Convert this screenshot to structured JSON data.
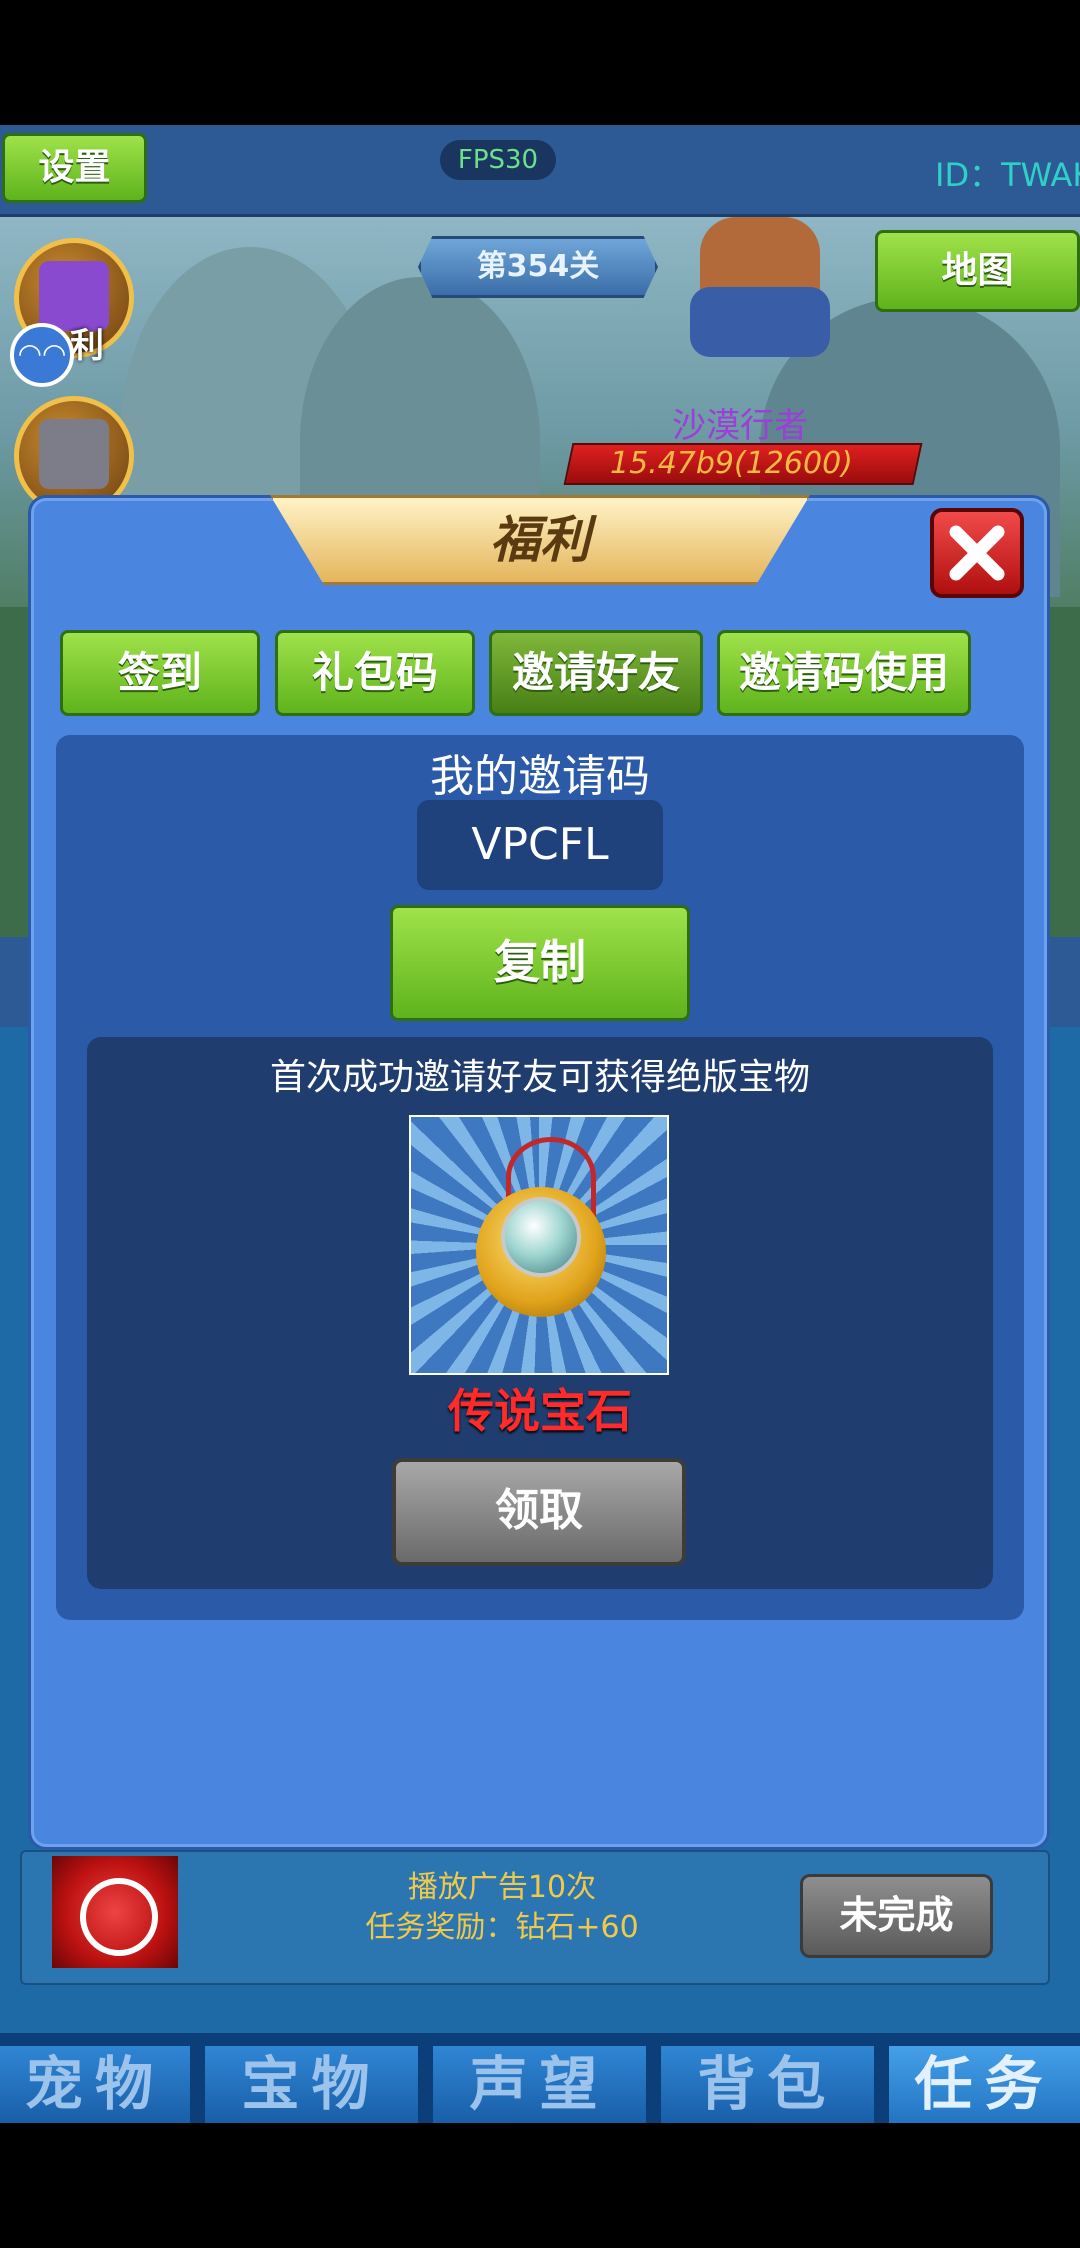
{
  "topbar": {
    "settings_label": "设置",
    "fps": "FPS30",
    "player_id": "ID：TWAK"
  },
  "scene": {
    "stage": "第354关",
    "map_label": "地图",
    "welfare_icon_label": "利",
    "enemy_name": "沙漠行者",
    "enemy_hp": "15.47b9(12600)"
  },
  "dialog": {
    "title": "福利",
    "tabs": [
      {
        "label": "签到",
        "active": false
      },
      {
        "label": "礼包码",
        "active": false
      },
      {
        "label": "邀请好友",
        "active": true
      },
      {
        "label": "邀请码使用",
        "active": false
      }
    ],
    "invite_title": "我的邀请码",
    "invite_code": "VPCFL",
    "copy_label": "复制",
    "reward_desc": "首次成功邀请好友可获得绝版宝物",
    "reward_name": "传说宝石",
    "claim_label": "领取"
  },
  "task": {
    "desc_line1": "播放广告10次",
    "desc_line2": "任务奖励：钻石+60",
    "status_label": "未完成"
  },
  "navbar": {
    "tabs": [
      {
        "label": "宠物",
        "active": false
      },
      {
        "label": "宝物",
        "active": false
      },
      {
        "label": "声望",
        "active": false
      },
      {
        "label": "背包",
        "active": false
      },
      {
        "label": "任务",
        "active": true
      }
    ]
  }
}
